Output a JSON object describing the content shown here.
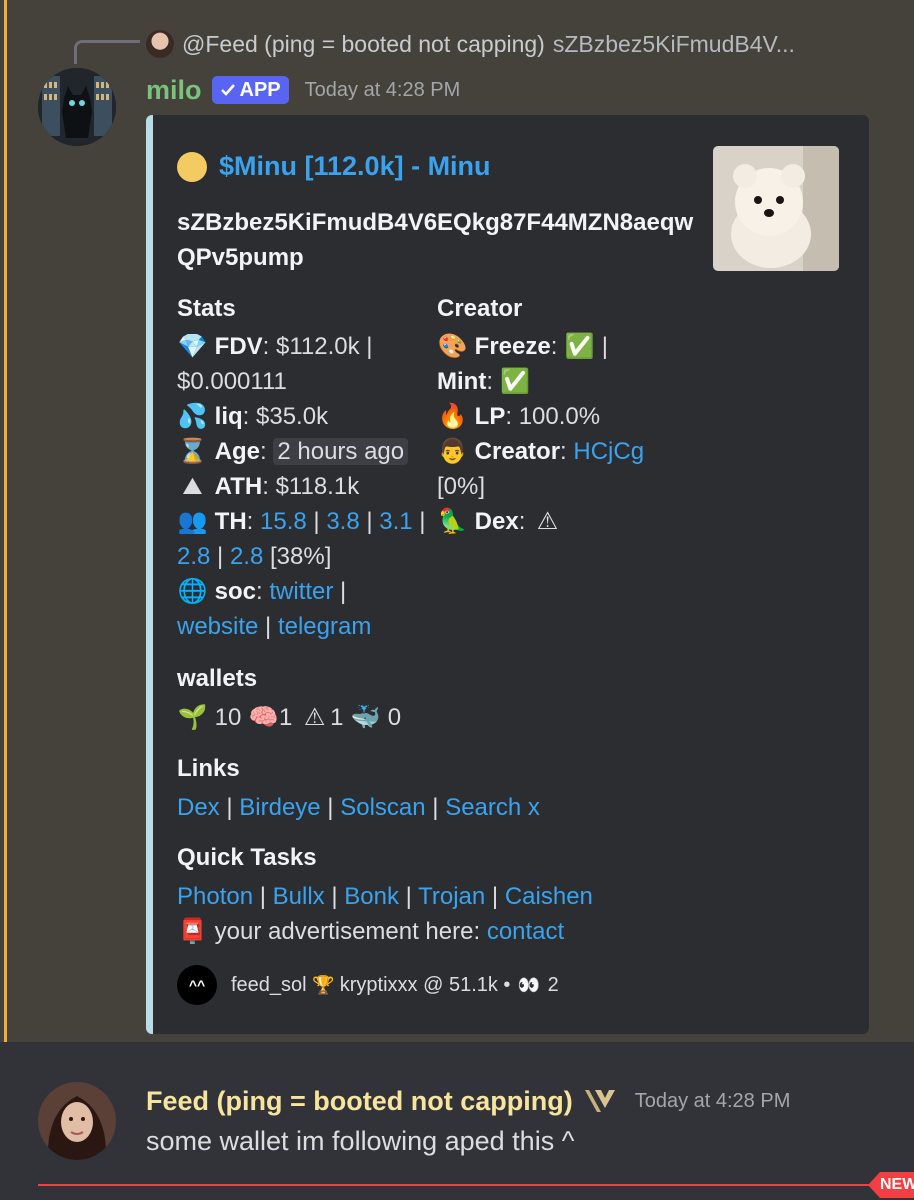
{
  "reply": {
    "author": "@Feed (ping = booted not capping)",
    "preview": "sZBzbez5KiFmudB4V..."
  },
  "bot_message": {
    "author": "milo",
    "badge": "APP",
    "timestamp": "Today at 4:28 PM"
  },
  "embed": {
    "title": "$Minu [112.0k] - Minu",
    "address": "sZBzbez5KiFmudB4V6EQkg87F44MZN8aeqwQPv5pump",
    "stats": {
      "heading": "Stats",
      "fdv_label": "FDV",
      "fdv_value": "$112.0k |",
      "price": "$0.000111",
      "liq_label": "liq",
      "liq_value": "$35.0k",
      "age_label": "Age",
      "age_value": "2 hours ago",
      "ath_label": "ATH",
      "ath_value": "$118.1k",
      "th_label": "TH",
      "th_values": [
        "15.8",
        "3.8",
        "3.1",
        "2.8",
        "2.8"
      ],
      "th_pct": "[38%]",
      "soc_label": "soc",
      "soc_links": [
        "twitter",
        "website",
        "telegram"
      ]
    },
    "creator": {
      "heading": "Creator",
      "freeze_label": "Freeze",
      "mint_label": "Mint",
      "lp_label": "LP",
      "lp_value": "100.0%",
      "creator_label": "Creator",
      "creator_value": "HCjCg",
      "creator_pct": "[0%]",
      "dex_label": "Dex"
    },
    "wallets": {
      "heading": "wallets",
      "seedling": "10",
      "brain": "1",
      "warning": "1",
      "whale": "0"
    },
    "links": {
      "heading": "Links",
      "items": [
        "Dex",
        "Birdeye",
        "Solscan",
        "Search x"
      ]
    },
    "quick_tasks": {
      "heading": "Quick Tasks",
      "items": [
        "Photon",
        "Bullx",
        "Bonk",
        "Trojan",
        "Caishen"
      ],
      "ad_text": "your advertisement here:",
      "ad_link": "contact"
    },
    "footer": {
      "avatar_text": "^^",
      "text_a": "feed_sol",
      "text_b": "kryptixxx @ 51.1k •",
      "eyes_count": "2"
    }
  },
  "user_message": {
    "author": "Feed (ping = booted not capping)",
    "timestamp": "Today at 4:28 PM",
    "text": "some wallet im following aped this ^"
  },
  "new_badge": "NEW",
  "colors": {
    "link": "#3aa3ef",
    "embed_border": "#b8dce8",
    "highlight_bar": "#f0b232",
    "new_line": "#f23f43"
  }
}
